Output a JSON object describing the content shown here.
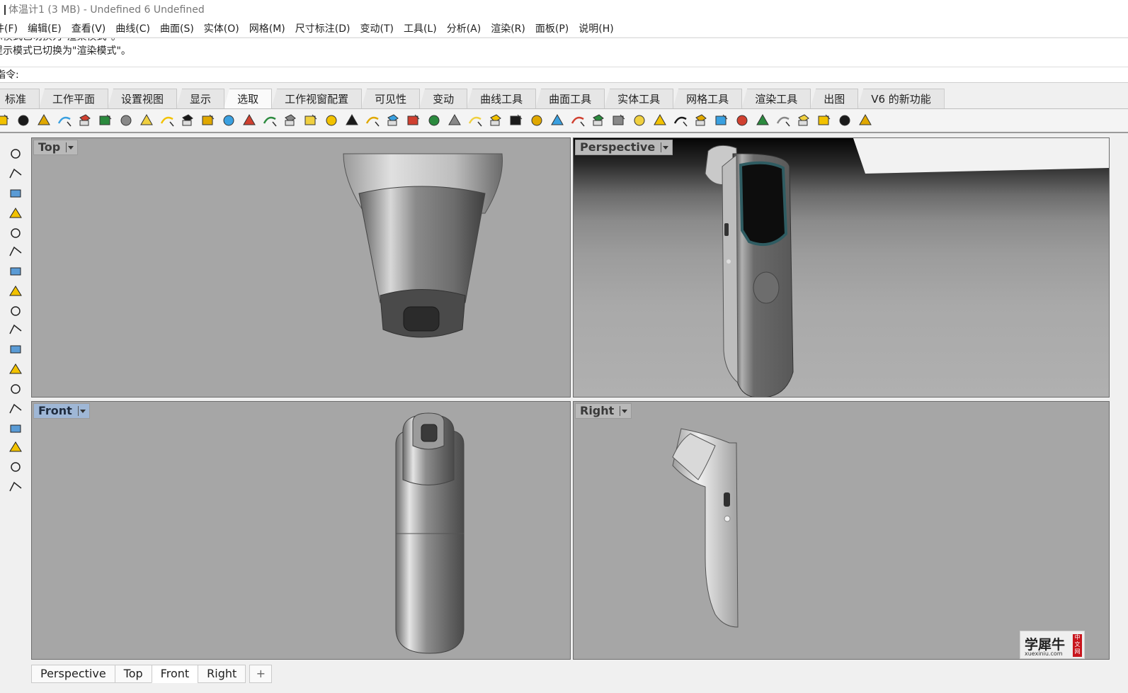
{
  "title": "体温计1 (3 MB) - Undefined 6 Undefined",
  "menu": [
    "件(F)",
    "编辑(E)",
    "查看(V)",
    "曲线(C)",
    "曲面(S)",
    "实体(O)",
    "网格(M)",
    "尺寸标注(D)",
    "变动(T)",
    "工具(L)",
    "分析(A)",
    "渲染(R)",
    "面板(P)",
    "说明(H)"
  ],
  "history": [
    "示模式已切换为\"渲染模式\"。",
    "提示模式已切换为\"渲染模式\"。"
  ],
  "command": {
    "label": "指令:",
    "value": ""
  },
  "toolbar_tabs": [
    "标准",
    "工作平面",
    "设置视图",
    "显示",
    "选取",
    "工作视窗配置",
    "可见性",
    "变动",
    "曲线工具",
    "曲面工具",
    "实体工具",
    "网格工具",
    "渲染工具",
    "出图",
    "V6 的新功能"
  ],
  "active_toolbar_tab": "选取",
  "toolbar_icons": [
    "select-all-icon",
    "select-none-icon",
    "invert-selection-icon",
    "select-last-icon",
    "select-previous-icon",
    "select-points-icon",
    "select-curves-icon",
    "select-surfaces-icon",
    "select-polysurfaces-icon",
    "select-color-icon",
    "select-layer-icon",
    "select-points-cloud-icon",
    "select-grips-icon",
    "select-open-icon",
    "select-lights-icon",
    "select-hatch-icon",
    "select-dimensions-icon",
    "select-annotations-icon",
    "select-groups-icon",
    "select-blocks-icon",
    "select-meshes-icon",
    "select-closed-icon",
    "select-duplicates-icon",
    "select-planar-icon",
    "select-text-icon",
    "select-small-icon",
    "select-chain-icon",
    "select-loop-icon",
    "select-edges-icon",
    "select-sphere-icon",
    "select-cube-icon",
    "select-render-icon",
    "select-materials-icon",
    "select-brush-icon",
    "select-zoom-icon",
    "select-filter-icon",
    "select-grid-icon",
    "select-box-icon",
    "select-frame-icon",
    "select-key-icon",
    "select-tools-icon",
    "select-paint-icon",
    "select-object-icon"
  ],
  "viewports": {
    "top": {
      "label": "Top"
    },
    "perspective": {
      "label": "Perspective"
    },
    "front": {
      "label": "Front"
    },
    "right": {
      "label": "Right"
    }
  },
  "active_viewport": "Front",
  "bottom_tabs": [
    "Perspective",
    "Top",
    "Front",
    "Right"
  ],
  "add_tab_label": "+",
  "watermark": {
    "main": "学犀牛",
    "sub": "xuexiniu.com",
    "seal": "中文网"
  },
  "colors": {
    "viewport_bg": "#a6a6a6",
    "active_label": "#9fb7d6",
    "inactive_label": "#b9b9b9"
  }
}
